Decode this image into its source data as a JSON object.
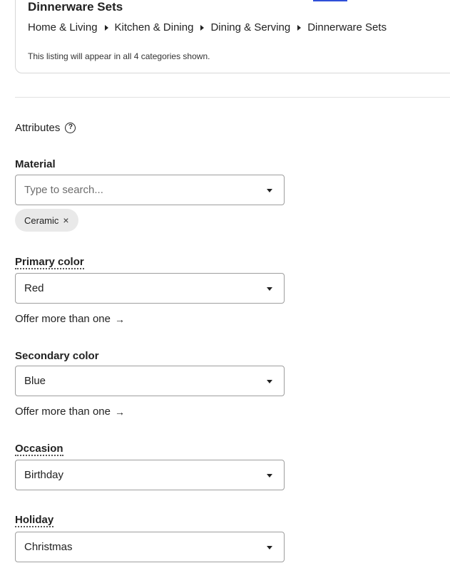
{
  "category": {
    "title": "Dinnerware Sets",
    "breadcrumb": [
      "Home & Living",
      "Kitchen & Dining",
      "Dining & Serving",
      "Dinnerware Sets"
    ],
    "note": "This listing will appear in all 4 categories shown."
  },
  "attributes": {
    "heading": "Attributes",
    "help_icon": "?"
  },
  "material": {
    "label": "Material",
    "placeholder": "Type to search...",
    "chips": [
      {
        "label": "Ceramic",
        "remove_icon": "×"
      }
    ]
  },
  "primary_color": {
    "label": "Primary color",
    "value": "Red",
    "offer_more": "Offer more than one",
    "arrow": "→"
  },
  "secondary_color": {
    "label": "Secondary color",
    "value": "Blue",
    "offer_more": "Offer more than one",
    "arrow": "→"
  },
  "occasion": {
    "label": "Occasion",
    "value": "Birthday"
  },
  "holiday": {
    "label": "Holiday",
    "value": "Christmas"
  }
}
